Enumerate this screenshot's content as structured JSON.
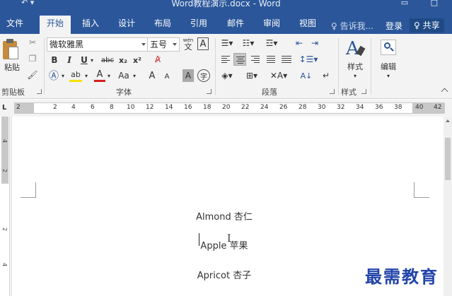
{
  "window": {
    "title": "Word教程演示.docx - Word"
  },
  "tabs": [
    {
      "label": "文件"
    },
    {
      "label": "开始"
    },
    {
      "label": "插入"
    },
    {
      "label": "设计"
    },
    {
      "label": "布局"
    },
    {
      "label": "引用"
    },
    {
      "label": "邮件"
    },
    {
      "label": "审阅"
    },
    {
      "label": "视图"
    }
  ],
  "active_tab": "开始",
  "tell_me": "♀ 告诉我...",
  "login": "登录",
  "share": "♀ 共享",
  "clipboard": {
    "paste_label": "粘贴",
    "group_label": "剪贴板"
  },
  "font": {
    "name": "微软雅黑",
    "size": "五号",
    "group_label": "字体",
    "bold": "B",
    "italic": "I",
    "underline": "U",
    "strike": "abc",
    "subscript": "x₂",
    "superscript": "x²",
    "change_case": "Aa",
    "grow": "A",
    "shrink": "A",
    "phonetic": "wén",
    "phonetic_char": "文",
    "border_char": "A",
    "shade_char": "A",
    "enclose_char": "字"
  },
  "paragraph": {
    "group_label": "段落"
  },
  "styles": {
    "label": "样式",
    "group_label": "样式"
  },
  "editing": {
    "label": "编辑"
  },
  "ruler": {
    "numbers": [
      "2",
      "2",
      "4",
      "6",
      "8",
      "10",
      "12",
      "14",
      "16",
      "18",
      "20",
      "22",
      "24",
      "26",
      "28",
      "30",
      "32",
      "34",
      "36",
      "38",
      "40",
      "42"
    ]
  },
  "vruler": {
    "numbers": [
      "4",
      "2",
      "2",
      "4"
    ]
  },
  "document": {
    "paragraphs": [
      {
        "text": "Almond 杏仁"
      },
      {
        "text": "Apple 苹果"
      },
      {
        "text": "Apricot 杏子"
      }
    ]
  },
  "watermark": "最需教育",
  "colors": {
    "accent": "#2b579a",
    "ribbon": "#f3f3f3",
    "watermark": "#2244aa"
  }
}
